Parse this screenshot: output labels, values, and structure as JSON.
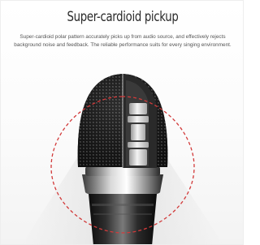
{
  "heading": {
    "title": "Super-cardioid pickup",
    "description": "Super-cardioid polar pattern accurately picks up from audio source, and effectively rejects background noise and feedback. The reliable performance suits for every singing environment."
  },
  "image": {
    "subject": "microphone-head-cutaway",
    "pickup_outline_color": "#d23a3a"
  }
}
